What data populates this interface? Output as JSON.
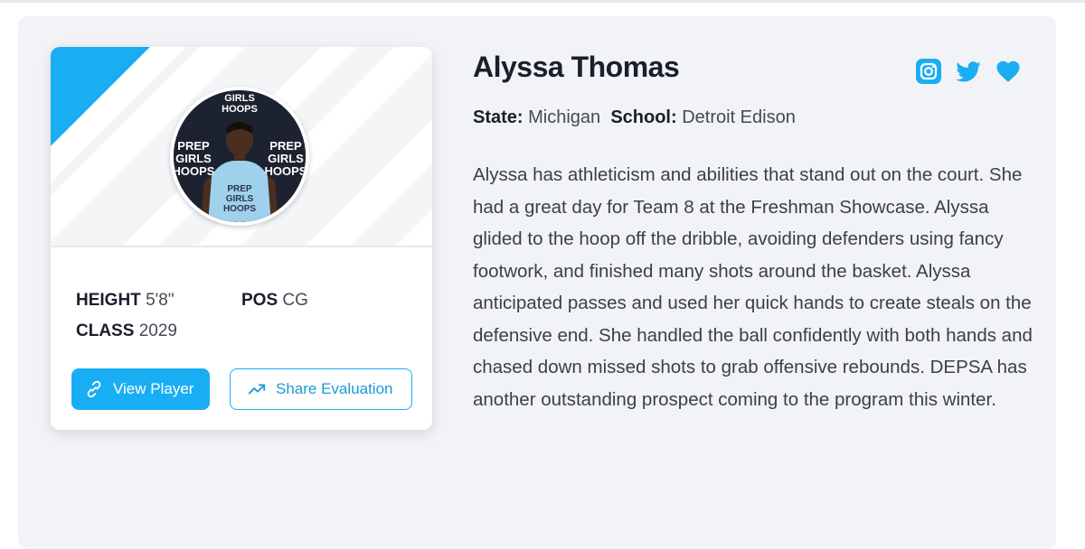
{
  "player": {
    "name": "Alyssa Thomas",
    "state_label": "State:",
    "state": "Michigan",
    "school_label": "School:",
    "school": "Detroit Edison",
    "bio": "Alyssa has athleticism and abilities that stand out on the court. She had a great day for Team 8 at the Freshman Showcase. Alyssa glided to the hoop off the dribble, avoiding defenders using fancy footwork, and finished many shots around the basket. Alyssa anticipated passes and used her quick hands to create steals on the defensive end. She handled the ball confidently with both hands and chased down missed shots to grab offensive rebounds. DEPSA has another outstanding prospect coming to the program this winter."
  },
  "stats": {
    "height_label": "HEIGHT",
    "height": "5'8\"",
    "pos_label": "POS",
    "pos": "CG",
    "class_label": "CLASS",
    "class": "2029"
  },
  "avatar": {
    "backdrop_text_left": [
      "PREP",
      "GIRLS",
      "HOOPS"
    ],
    "backdrop_text_right": [
      "PREP",
      "GIRLS",
      "HOOPS"
    ],
    "backdrop_text_top": [
      "GIRLS",
      "HOOPS"
    ],
    "jersey_text": [
      "PREP",
      "GIRLS",
      "HOOPS"
    ]
  },
  "buttons": {
    "view_player": "View Player",
    "share_evaluation": "Share Evaluation"
  },
  "social": [
    "instagram-icon",
    "twitter-icon",
    "heart-icon"
  ],
  "colors": {
    "accent": "#19aef4",
    "text_dark": "#1a1f2b",
    "panel_bg": "#f2f3f6"
  }
}
